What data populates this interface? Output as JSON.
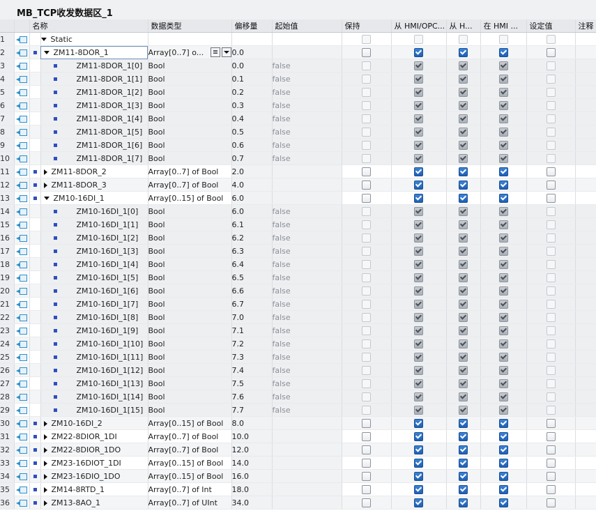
{
  "window": {
    "title": "MB_TCP收发数据区_1"
  },
  "columns": {
    "name": "名称",
    "datatype": "数据类型",
    "offset": "偏移量",
    "start": "起始值",
    "retain": "保持",
    "from_hmi_opc": "从 HMI/OPC...",
    "from_h": "从 H...",
    "in_hmi": "在 HMI ...",
    "setpoint": "设定值",
    "comment": "注释"
  },
  "rows": [
    {
      "num": "1",
      "level": 0,
      "expand": "open",
      "name": "Static",
      "type": "",
      "offset": "",
      "start": "",
      "checks": "dis"
    },
    {
      "num": "2",
      "level": 1,
      "expand": "open",
      "name": "ZM11-8DOR_1",
      "type": "Array[0..7] o...",
      "offset": "0.0",
      "start": "",
      "checks": "parent",
      "selected": true
    },
    {
      "num": "3",
      "level": 2,
      "expand": "",
      "name": "ZM11-8DOR_1[0]",
      "type": "Bool",
      "offset": "0.0",
      "start": "false",
      "checks": "child"
    },
    {
      "num": "4",
      "level": 2,
      "expand": "",
      "name": "ZM11-8DOR_1[1]",
      "type": "Bool",
      "offset": "0.1",
      "start": "false",
      "checks": "child"
    },
    {
      "num": "5",
      "level": 2,
      "expand": "",
      "name": "ZM11-8DOR_1[2]",
      "type": "Bool",
      "offset": "0.2",
      "start": "false",
      "checks": "child"
    },
    {
      "num": "6",
      "level": 2,
      "expand": "",
      "name": "ZM11-8DOR_1[3]",
      "type": "Bool",
      "offset": "0.3",
      "start": "false",
      "checks": "child"
    },
    {
      "num": "7",
      "level": 2,
      "expand": "",
      "name": "ZM11-8DOR_1[4]",
      "type": "Bool",
      "offset": "0.4",
      "start": "false",
      "checks": "child"
    },
    {
      "num": "8",
      "level": 2,
      "expand": "",
      "name": "ZM11-8DOR_1[5]",
      "type": "Bool",
      "offset": "0.5",
      "start": "false",
      "checks": "child"
    },
    {
      "num": "9",
      "level": 2,
      "expand": "",
      "name": "ZM11-8DOR_1[6]",
      "type": "Bool",
      "offset": "0.6",
      "start": "false",
      "checks": "child"
    },
    {
      "num": "10",
      "level": 2,
      "expand": "",
      "name": "ZM11-8DOR_1[7]",
      "type": "Bool",
      "offset": "0.7",
      "start": "false",
      "checks": "child"
    },
    {
      "num": "11",
      "level": 1,
      "expand": "closed",
      "name": "ZM11-8DOR_2",
      "type": "Array[0..7] of Bool",
      "offset": "2.0",
      "start": "",
      "checks": "parent"
    },
    {
      "num": "12",
      "level": 1,
      "expand": "closed",
      "name": "ZM11-8DOR_3",
      "type": "Array[0..7] of Bool",
      "offset": "4.0",
      "start": "",
      "checks": "parent"
    },
    {
      "num": "13",
      "level": 1,
      "expand": "open",
      "name": "ZM10-16DI_1",
      "type": "Array[0..15] of Bool",
      "offset": "6.0",
      "start": "",
      "checks": "parent"
    },
    {
      "num": "14",
      "level": 2,
      "expand": "",
      "name": "ZM10-16DI_1[0]",
      "type": "Bool",
      "offset": "6.0",
      "start": "false",
      "checks": "child"
    },
    {
      "num": "15",
      "level": 2,
      "expand": "",
      "name": "ZM10-16DI_1[1]",
      "type": "Bool",
      "offset": "6.1",
      "start": "false",
      "checks": "child"
    },
    {
      "num": "16",
      "level": 2,
      "expand": "",
      "name": "ZM10-16DI_1[2]",
      "type": "Bool",
      "offset": "6.2",
      "start": "false",
      "checks": "child"
    },
    {
      "num": "17",
      "level": 2,
      "expand": "",
      "name": "ZM10-16DI_1[3]",
      "type": "Bool",
      "offset": "6.3",
      "start": "false",
      "checks": "child"
    },
    {
      "num": "18",
      "level": 2,
      "expand": "",
      "name": "ZM10-16DI_1[4]",
      "type": "Bool",
      "offset": "6.4",
      "start": "false",
      "checks": "child"
    },
    {
      "num": "19",
      "level": 2,
      "expand": "",
      "name": "ZM10-16DI_1[5]",
      "type": "Bool",
      "offset": "6.5",
      "start": "false",
      "checks": "child"
    },
    {
      "num": "20",
      "level": 2,
      "expand": "",
      "name": "ZM10-16DI_1[6]",
      "type": "Bool",
      "offset": "6.6",
      "start": "false",
      "checks": "child"
    },
    {
      "num": "21",
      "level": 2,
      "expand": "",
      "name": "ZM10-16DI_1[7]",
      "type": "Bool",
      "offset": "6.7",
      "start": "false",
      "checks": "child"
    },
    {
      "num": "22",
      "level": 2,
      "expand": "",
      "name": "ZM10-16DI_1[8]",
      "type": "Bool",
      "offset": "7.0",
      "start": "false",
      "checks": "child"
    },
    {
      "num": "23",
      "level": 2,
      "expand": "",
      "name": "ZM10-16DI_1[9]",
      "type": "Bool",
      "offset": "7.1",
      "start": "false",
      "checks": "child"
    },
    {
      "num": "24",
      "level": 2,
      "expand": "",
      "name": "ZM10-16DI_1[10]",
      "type": "Bool",
      "offset": "7.2",
      "start": "false",
      "checks": "child"
    },
    {
      "num": "25",
      "level": 2,
      "expand": "",
      "name": "ZM10-16DI_1[11]",
      "type": "Bool",
      "offset": "7.3",
      "start": "false",
      "checks": "child"
    },
    {
      "num": "26",
      "level": 2,
      "expand": "",
      "name": "ZM10-16DI_1[12]",
      "type": "Bool",
      "offset": "7.4",
      "start": "false",
      "checks": "child"
    },
    {
      "num": "27",
      "level": 2,
      "expand": "",
      "name": "ZM10-16DI_1[13]",
      "type": "Bool",
      "offset": "7.5",
      "start": "false",
      "checks": "child"
    },
    {
      "num": "28",
      "level": 2,
      "expand": "",
      "name": "ZM10-16DI_1[14]",
      "type": "Bool",
      "offset": "7.6",
      "start": "false",
      "checks": "child"
    },
    {
      "num": "29",
      "level": 2,
      "expand": "",
      "name": "ZM10-16DI_1[15]",
      "type": "Bool",
      "offset": "7.7",
      "start": "false",
      "checks": "child"
    },
    {
      "num": "30",
      "level": 1,
      "expand": "closed",
      "name": "ZM10-16DI_2",
      "type": "Array[0..15] of Bool",
      "offset": "8.0",
      "start": "",
      "checks": "parent"
    },
    {
      "num": "31",
      "level": 1,
      "expand": "closed",
      "name": "ZM22-8DIOR_1DI",
      "type": "Array[0..7] of Bool",
      "offset": "10.0",
      "start": "",
      "checks": "parent"
    },
    {
      "num": "32",
      "level": 1,
      "expand": "closed",
      "name": "ZM22-8DIOR_1DO",
      "type": "Array[0..7] of Bool",
      "offset": "12.0",
      "start": "",
      "checks": "parent"
    },
    {
      "num": "33",
      "level": 1,
      "expand": "closed",
      "name": "ZM23-16DIOT_1DI",
      "type": "Array[0..15] of Bool",
      "offset": "14.0",
      "start": "",
      "checks": "parent"
    },
    {
      "num": "34",
      "level": 1,
      "expand": "closed",
      "name": "ZM23-16DIO_1DO",
      "type": "Array[0..15] of Bool",
      "offset": "16.0",
      "start": "",
      "checks": "parent"
    },
    {
      "num": "35",
      "level": 1,
      "expand": "closed",
      "name": "ZM14-8RTD_1",
      "type": "Array[0..7] of Int",
      "offset": "18.0",
      "start": "",
      "checks": "parent"
    },
    {
      "num": "36",
      "level": 1,
      "expand": "closed",
      "name": "ZM13-8AO_1",
      "type": "Array[0..7] of UInt",
      "offset": "34.0",
      "start": "",
      "checks": "parent"
    }
  ]
}
